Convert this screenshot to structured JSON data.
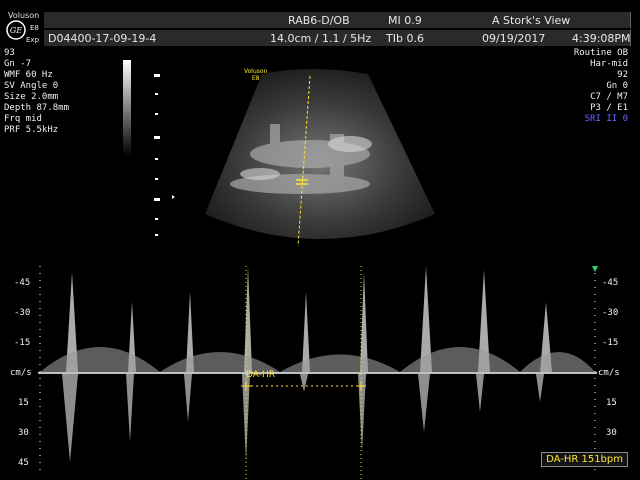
{
  "header": {
    "brand": "Voluson",
    "model": "E8",
    "exp": "Exp",
    "patient_id": "D04400-17-09-19-4",
    "probe": "RAB6-D/OB",
    "mi": "MI 0.9",
    "clinic": "A Stork's View",
    "depth_info": "14.0cm / 1.1 / 5Hz",
    "tib": "TIb 0.6",
    "date": "09/19/2017",
    "time": "4:39:08PM"
  },
  "left_params": [
    "93",
    "Gn -7",
    "WMF 60 Hz",
    "SV Angle 0",
    "Size 2.0mm",
    "Depth 87.8mm",
    "Frq mid",
    "PRF 5.5kHz"
  ],
  "right_params": [
    "Routine OB",
    "Har-mid",
    "92",
    "Gn 0",
    "C7 / M7",
    "P3 / E1"
  ],
  "right_sri": "SRI II 0",
  "image_overlay": {
    "brand": "Voluson",
    "model": "E8"
  },
  "scale_left": [
    "-45",
    "-30",
    "-15",
    "cm/s",
    "15",
    "30",
    "45"
  ],
  "scale_right": [
    "-45",
    "-30",
    "-15",
    "cm/s",
    "15",
    "30",
    "45"
  ],
  "da_inline_label": "DA-HR",
  "da_badge": "DA-HR 151bpm",
  "colors": {
    "accent_yellow": "#ffe433",
    "sri_blue": "#6b6bff",
    "header_bg": "#2a2a2a"
  }
}
